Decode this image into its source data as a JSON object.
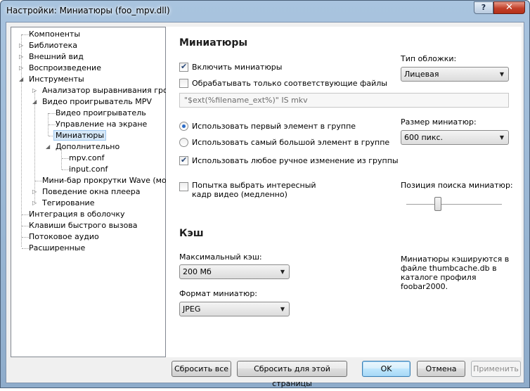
{
  "window": {
    "title": "Настройки: Миниатюры (foo_mpv.dll)",
    "help": "?",
    "close": "✕"
  },
  "tree": {
    "items": [
      {
        "label": "Компоненты"
      },
      {
        "label": "Библиотека"
      },
      {
        "label": "Внешний вид"
      },
      {
        "label": "Воспроизведение"
      },
      {
        "label": "Инструменты"
      },
      {
        "label": "Анализатор выравнивания громкости"
      },
      {
        "label": "Видео проигрыватель MPV"
      },
      {
        "label": "Видео проигрыватель"
      },
      {
        "label": "Управление на экране"
      },
      {
        "label": "Миниатюры"
      },
      {
        "label": "Дополнительно"
      },
      {
        "label": "mpv.conf"
      },
      {
        "label": "input.conf"
      },
      {
        "label": "Мини-бар прокрутки Wave (мод)"
      },
      {
        "label": "Поведение окна плеера"
      },
      {
        "label": "Тегирование"
      },
      {
        "label": "Интеграция в оболочку"
      },
      {
        "label": "Клавиши быстрого вызова"
      },
      {
        "label": "Потоковое аудио"
      },
      {
        "label": "Расширенные"
      }
    ],
    "expand_glyph": "▷",
    "collapse_glyph": "◢"
  },
  "thumbs": {
    "heading": "Миниатюры",
    "enable_label": "Включить миниатюры",
    "enable_checked": true,
    "only_matching_label": "Обрабатывать только соответствующие файлы",
    "only_matching_checked": false,
    "filter_value": "\"$ext(%filename_ext%)\" IS mkv",
    "radio_first_label": "Использовать первый элемент в группе",
    "radio_largest_label": "Использовать самый большой элемент в группе",
    "manual_change_label": "Использовать любое ручное изменение из группы",
    "manual_change_checked": true,
    "interesting_frame_label_1": "Попытка выбрать интересный",
    "interesting_frame_label_2": "кадр видео (медленно)",
    "interesting_frame_checked": false,
    "cover_type_label": "Тип обложки:",
    "cover_type_value": "Лицевая",
    "size_label": "Размер миниатюр:",
    "size_value": "600 пикс.",
    "seek_label": "Позиция поиска миниатюр:",
    "seek_position_fraction": 0.33
  },
  "cache": {
    "heading": "Кэш",
    "max_label": "Максимальный кэш:",
    "max_value": "200 Мб",
    "format_label": "Формат миниатюр:",
    "format_value": "JPEG",
    "note_1": "Миниатюры кэшируются в",
    "note_2": "файле thumbcache.db в",
    "note_3": "каталоге профиля",
    "note_4": "foobar2000."
  },
  "buttons": {
    "reset_all": "Сбросить все",
    "reset_page": "Сбросить для этой страницы",
    "ok": "OK",
    "cancel": "Отмена",
    "apply": "Применить"
  },
  "combo_arrow": "▼"
}
